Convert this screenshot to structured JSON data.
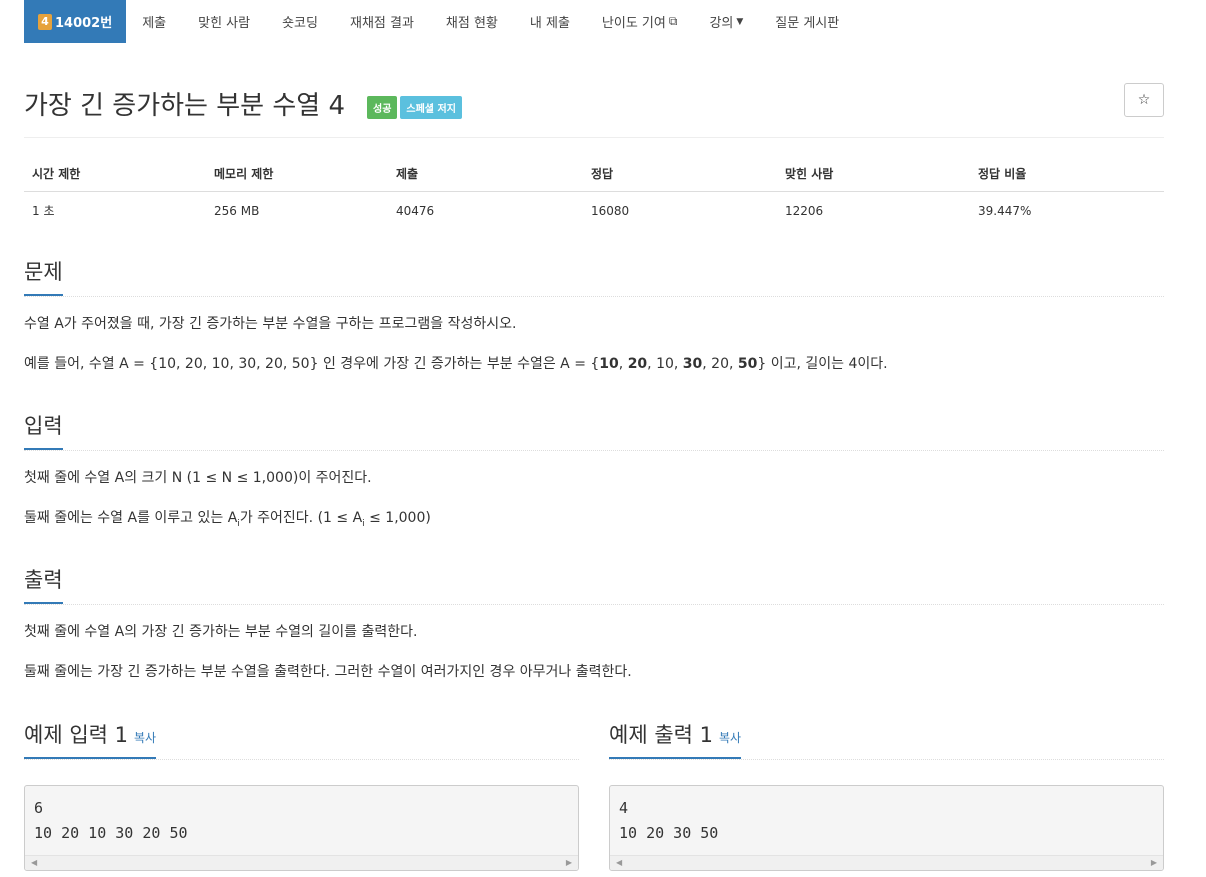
{
  "nav": {
    "problem_id": "14002번",
    "tier_badge": "4",
    "items": [
      "제출",
      "맞힌 사람",
      "숏코딩",
      "재채점 결과",
      "채점 현황",
      "내 제출",
      "난이도 기여",
      "강의",
      "질문 게시판"
    ]
  },
  "problem": {
    "title": "가장 긴 증가하는 부분 수열 4",
    "badge_success": "성공",
    "badge_special": "스페셜 저지",
    "star": "☆"
  },
  "info": {
    "headers": [
      "시간 제한",
      "메모리 제한",
      "제출",
      "정답",
      "맞힌 사람",
      "정답 비율"
    ],
    "values": [
      "1 초",
      "256 MB",
      "40476",
      "16080",
      "12206",
      "39.447%"
    ]
  },
  "description": {
    "heading": "문제",
    "line1": "수열 A가 주어졌을 때, 가장 긴 증가하는 부분 수열을 구하는 프로그램을 작성하시오.",
    "line2_a": "예를 들어, 수열 A = {10, 20, 10, 30, 20, 50} 인 경우에 가장 긴 증가하는 부분 수열은 A = {",
    "b1": "10",
    "sep1": ", ",
    "b2": "20",
    "sep2": ", 10, ",
    "b3": "30",
    "sep3": ", 20, ",
    "b4": "50",
    "line2_b": "} 이고, 길이는 4이다."
  },
  "input": {
    "heading": "입력",
    "line1": "첫째 줄에 수열 A의 크기 N (1 ≤ N ≤ 1,000)이 주어진다.",
    "line2_a": "둘째 줄에는 수열 A를 이루고 있는 A",
    "line2_sub": "i",
    "line2_b": "가 주어진다. (1 ≤ A",
    "line2_sub2": "i",
    "line2_c": " ≤ 1,000)"
  },
  "output": {
    "heading": "출력",
    "line1": "첫째 줄에 수열 A의 가장 긴 증가하는 부분 수열의 길이를 출력한다.",
    "line2": "둘째 줄에는 가장 긴 증가하는 부분 수열을 출력한다. 그러한 수열이 여러가지인 경우 아무거나 출력한다."
  },
  "examples": {
    "input_heading": "예제 입력 1",
    "output_heading": "예제 출력 1",
    "copy_label": "복사",
    "input_text": "6\n10 20 10 30 20 50",
    "output_text": "4\n10 20 30 50"
  }
}
